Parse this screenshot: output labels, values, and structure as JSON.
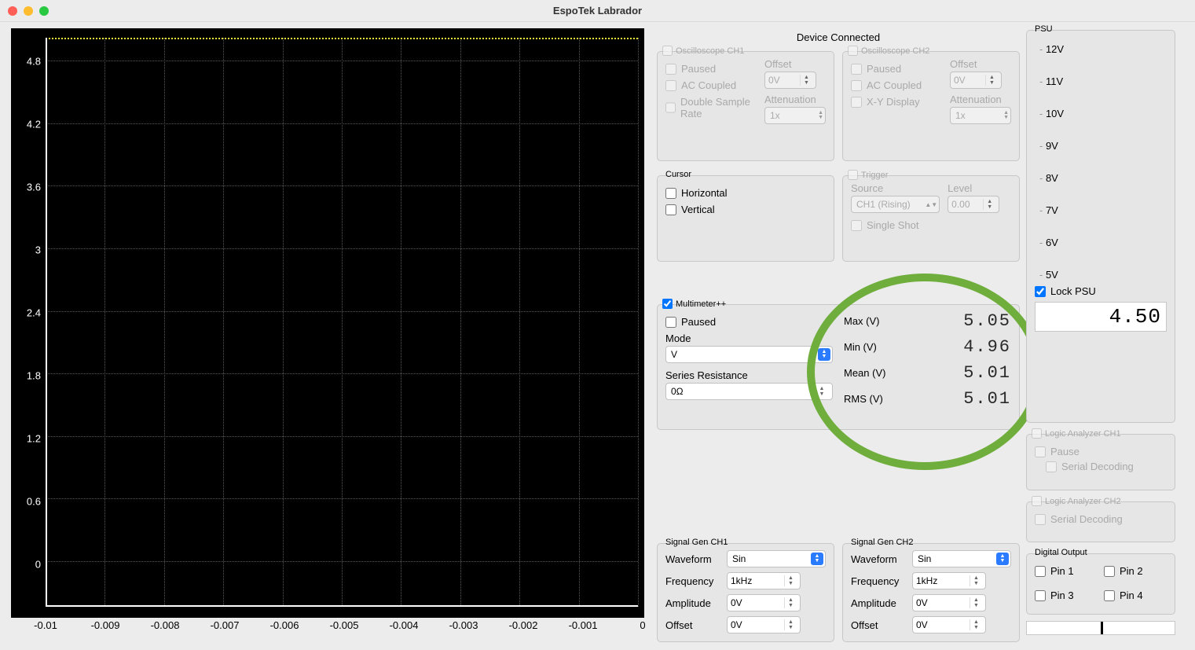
{
  "window": {
    "title": "EspoTek Labrador"
  },
  "status": "Device Connected",
  "scope": {
    "y_ticks": [
      "4.8",
      "4.2",
      "3.6",
      "3",
      "2.4",
      "1.8",
      "1.2",
      "0.6",
      "0"
    ],
    "x_ticks": [
      "-0.01",
      "-0.009",
      "-0.008",
      "-0.007",
      "-0.006",
      "-0.005",
      "-0.004",
      "-0.003",
      "-0.002",
      "-0.001",
      "0"
    ]
  },
  "osc_ch1": {
    "title": "Oscilloscope CH1",
    "paused": "Paused",
    "ac": "AC Coupled",
    "dsr": "Double Sample Rate",
    "offset_label": "Offset",
    "offset": "0V",
    "atten_label": "Attenuation",
    "atten": "1x"
  },
  "osc_ch2": {
    "title": "Oscilloscope CH2",
    "paused": "Paused",
    "ac": "AC Coupled",
    "xy": "X-Y Display",
    "offset_label": "Offset",
    "offset": "0V",
    "atten_label": "Attenuation",
    "atten": "1x"
  },
  "cursor": {
    "title": "Cursor",
    "h": "Horizontal",
    "v": "Vertical"
  },
  "trigger": {
    "title": "Trigger",
    "source_label": "Source",
    "source": "CH1 (Rising)",
    "level_label": "Level",
    "level": "0.00",
    "single": "Single Shot"
  },
  "multimeter": {
    "title": "Multimeter++",
    "paused": "Paused",
    "mode_label": "Mode",
    "mode": "V",
    "series_label": "Series Resistance",
    "series": "0Ω",
    "rows": [
      {
        "label": "Max (V)",
        "value": "5.05"
      },
      {
        "label": "Min (V)",
        "value": "4.96"
      },
      {
        "label": "Mean (V)",
        "value": "5.01"
      },
      {
        "label": "RMS (V)",
        "value": "5.01"
      }
    ]
  },
  "siggen1": {
    "title": "Signal Gen CH1",
    "waveform_label": "Waveform",
    "waveform": "Sin",
    "freq_label": "Frequency",
    "freq": "1kHz",
    "amp_label": "Amplitude",
    "amp": "0V",
    "off_label": "Offset",
    "off": "0V"
  },
  "siggen2": {
    "title": "Signal Gen CH2",
    "waveform_label": "Waveform",
    "waveform": "Sin",
    "freq_label": "Frequency",
    "freq": "1kHz",
    "amp_label": "Amplitude",
    "amp": "0V",
    "off_label": "Offset",
    "off": "0V"
  },
  "psu": {
    "title": "PSU",
    "ticks": [
      "12V",
      "11V",
      "10V",
      "9V",
      "8V",
      "7V",
      "6V",
      "5V"
    ],
    "lock": "Lock PSU",
    "value": "4.50"
  },
  "la1": {
    "title": "Logic Analyzer CH1",
    "pause": "Pause",
    "serial": "Serial Decoding"
  },
  "la2": {
    "title": "Logic Analyzer CH2",
    "serial": "Serial Decoding"
  },
  "dout": {
    "title": "Digital Output",
    "p1": "Pin 1",
    "p2": "Pin 2",
    "p3": "Pin 3",
    "p4": "Pin 4"
  },
  "chart_data": {
    "type": "line",
    "xlabel": "",
    "ylabel": "",
    "xlim": [
      -0.01,
      0
    ],
    "ylim": [
      0,
      5.1
    ],
    "series": [
      {
        "name": "CH1",
        "approx_constant": 5.0
      }
    ]
  }
}
